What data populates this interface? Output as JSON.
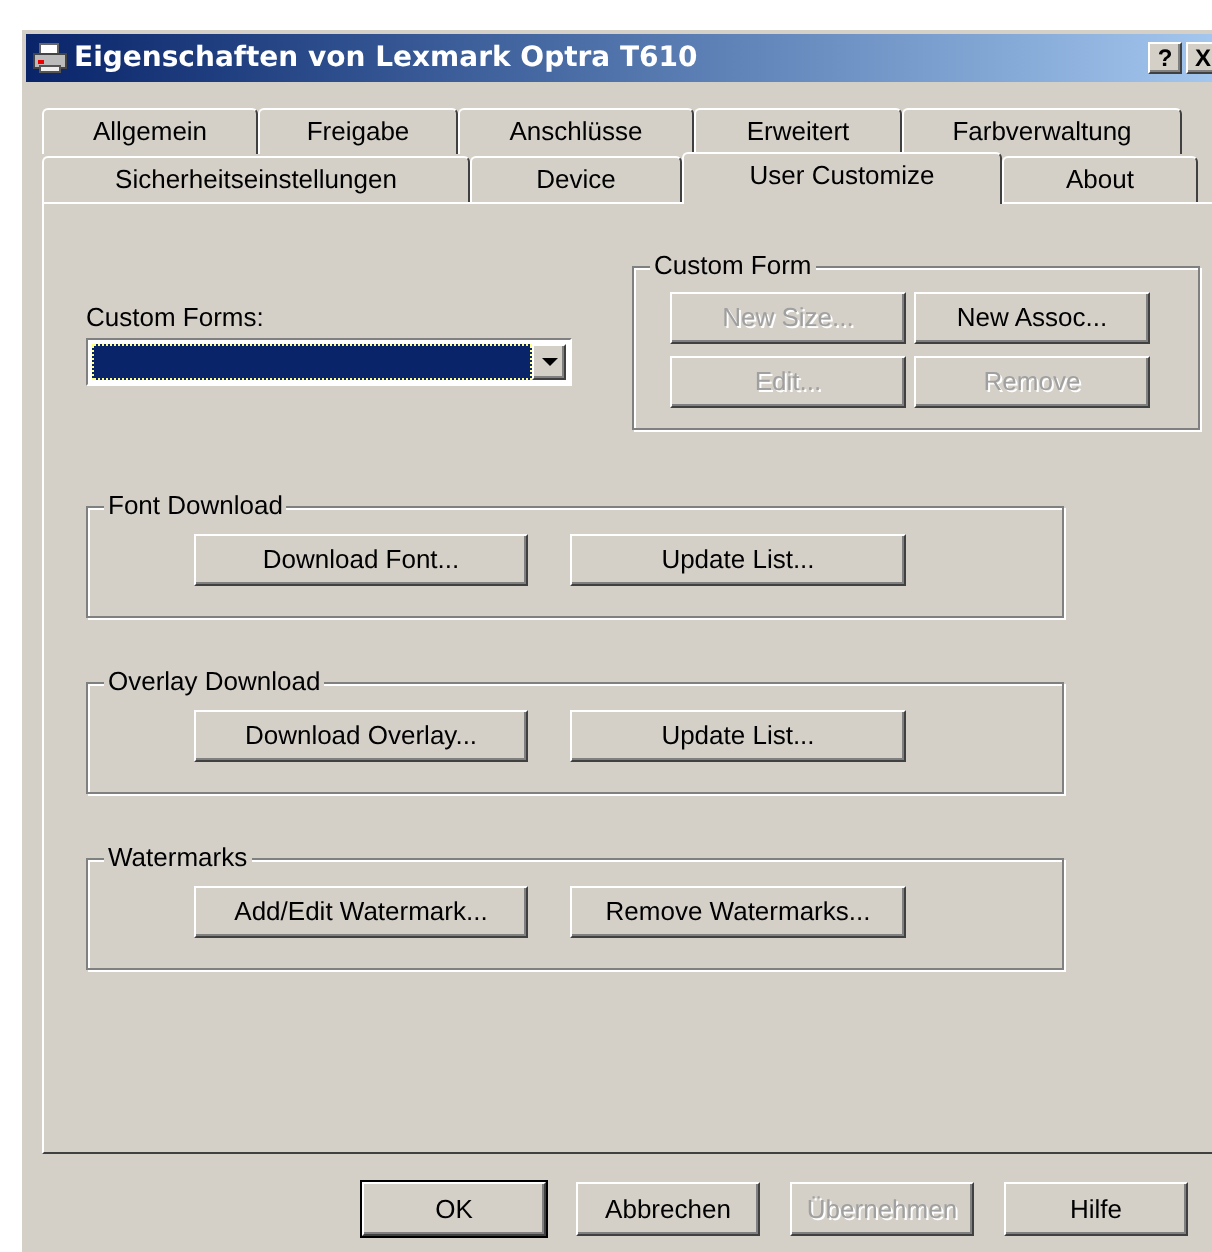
{
  "window": {
    "title": "Eigenschaften von Lexmark Optra T610",
    "help_button": "?",
    "close_button": "X"
  },
  "tab_rows": [
    [
      {
        "label": "Allgemein",
        "selected": false
      },
      {
        "label": "Freigabe",
        "selected": false
      },
      {
        "label": "Anschlüsse",
        "selected": false
      },
      {
        "label": "Erweitert",
        "selected": false
      },
      {
        "label": "Farbverwaltung",
        "selected": false
      }
    ],
    [
      {
        "label": "Sicherheitseinstellungen",
        "selected": false
      },
      {
        "label": "Device",
        "selected": false
      },
      {
        "label": "User Customize",
        "selected": true
      },
      {
        "label": "About",
        "selected": false
      }
    ]
  ],
  "custom_forms": {
    "label": "Custom Forms:"
  },
  "custom_form_group": {
    "title": "Custom Form",
    "buttons": [
      {
        "label": "New Size...",
        "disabled": true
      },
      {
        "label": "New Assoc...",
        "disabled": false
      },
      {
        "label": "Edit...",
        "disabled": true
      },
      {
        "label": "Remove",
        "disabled": true
      }
    ]
  },
  "groups": [
    {
      "title": "Font Download",
      "buttons": [
        {
          "label": "Download Font..."
        },
        {
          "label": "Update List..."
        }
      ]
    },
    {
      "title": "Overlay Download",
      "buttons": [
        {
          "label": "Download Overlay..."
        },
        {
          "label": "Update List..."
        }
      ]
    },
    {
      "title": "Watermarks",
      "buttons": [
        {
          "label": "Add/Edit Watermark..."
        },
        {
          "label": "Remove Watermarks..."
        }
      ]
    }
  ],
  "dialog_buttons": [
    {
      "label": "OK",
      "default": true,
      "disabled": false
    },
    {
      "label": "Abbrechen",
      "default": false,
      "disabled": false
    },
    {
      "label": "Übernehmen",
      "default": false,
      "disabled": true
    },
    {
      "label": "Hilfe",
      "default": false,
      "disabled": false
    }
  ]
}
